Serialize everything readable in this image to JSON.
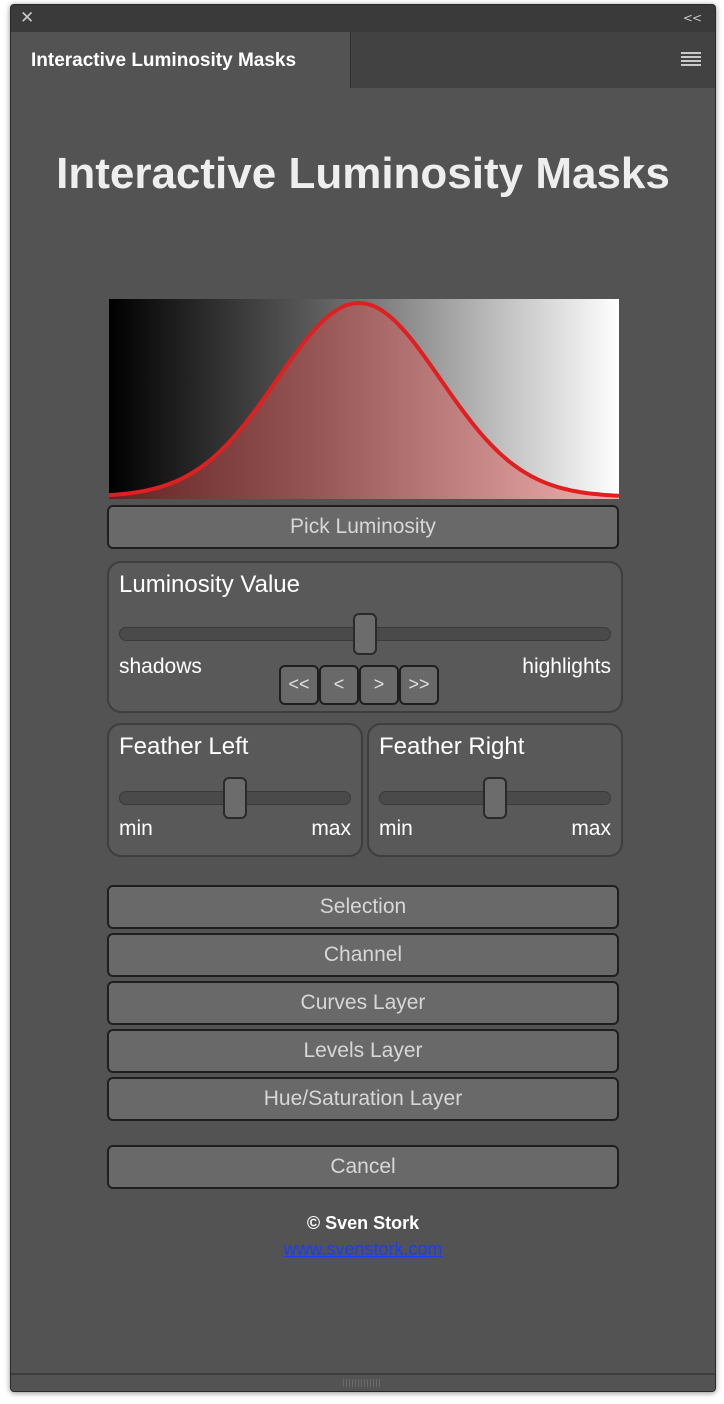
{
  "window": {
    "close_glyph": "✕",
    "collapse_glyph": "<<",
    "tab_label": "Interactive Luminosity Masks"
  },
  "panel": {
    "title": "Interactive Luminosity Masks"
  },
  "graph": {
    "curve_color": "#e02020",
    "fill_color": "#e05050",
    "peak_position": 0.49,
    "gradient_colors": [
      "#000000",
      "#ffffff"
    ]
  },
  "pick_button": {
    "label": "Pick Luminosity"
  },
  "luminosity": {
    "title": "Luminosity Value",
    "value": 0.5,
    "left_label": "shadows",
    "right_label": "highlights",
    "steps": [
      "<<",
      "<",
      ">",
      ">>"
    ]
  },
  "feather_left": {
    "title": "Feather Left",
    "value": 0.5,
    "min_label": "min",
    "max_label": "max"
  },
  "feather_right": {
    "title": "Feather Right",
    "value": 0.5,
    "min_label": "min",
    "max_label": "max"
  },
  "actions": [
    {
      "label": "Selection"
    },
    {
      "label": "Channel"
    },
    {
      "label": "Curves Layer"
    },
    {
      "label": "Levels Layer"
    },
    {
      "label": "Hue/Saturation Layer"
    }
  ],
  "cancel_button": {
    "label": "Cancel"
  },
  "footer": {
    "credit": "© Sven Stork",
    "link": "www.svenstork.com"
  },
  "colors": {
    "panel_bg": "#535353",
    "button_bg": "#696969",
    "link": "#1a3cff"
  }
}
